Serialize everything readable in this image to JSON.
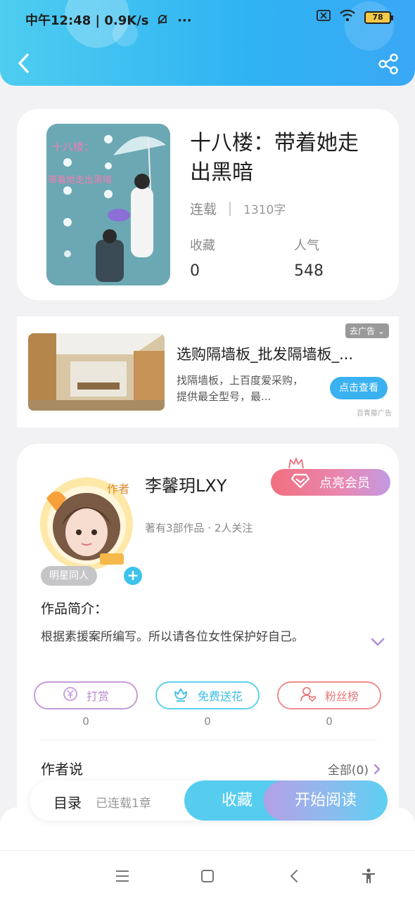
{
  "status_bar": {
    "time_speed": "中午12:48 | 0.9K/s",
    "more": "···",
    "battery": "78"
  },
  "book": {
    "title": "十八楼：带着她走出黑暗",
    "cover_text_1": "十八楼：",
    "cover_text_2": "带着她走出黑暗",
    "status": "连载",
    "word_count": "1310字",
    "favorites_label": "收藏",
    "favorites_value": "0",
    "popularity_label": "人气",
    "popularity_value": "548"
  },
  "ad": {
    "title": "选购隔墙板_批发隔墙板_...",
    "description": "找隔墙板，上百度爱采购，提供最全型号，最...",
    "tag": "去广告 ⌄",
    "button": "点击查看",
    "source": "百青藤广告"
  },
  "author": {
    "avatar_badge": "作者",
    "name": "李馨玥LXY",
    "stats": "著有3部作品 · 2人关注",
    "vip_button": "点亮会员",
    "tag": "明星同人",
    "tag_add": "+",
    "intro_label": "作品简介：",
    "intro_text": "根据素援案所编写。所以请各位女性保护好自己。",
    "actions": [
      {
        "label": "打赏",
        "count": "0",
        "icon": "yen-icon"
      },
      {
        "label": "免费送花",
        "count": "0",
        "icon": "flower-icon"
      },
      {
        "label": "粉丝榜",
        "count": "0",
        "icon": "fans-icon"
      }
    ],
    "author_says_label": "作者说",
    "author_says_all": "全部(0)"
  },
  "bottom_bar": {
    "toc_label": "目录",
    "chapters": "已连载1章",
    "favorite_button": "收藏",
    "read_button": "开始阅读"
  },
  "colors": {
    "header": "#2fb3f3",
    "accent": "#56cdef",
    "vip": "#f16f7d"
  }
}
